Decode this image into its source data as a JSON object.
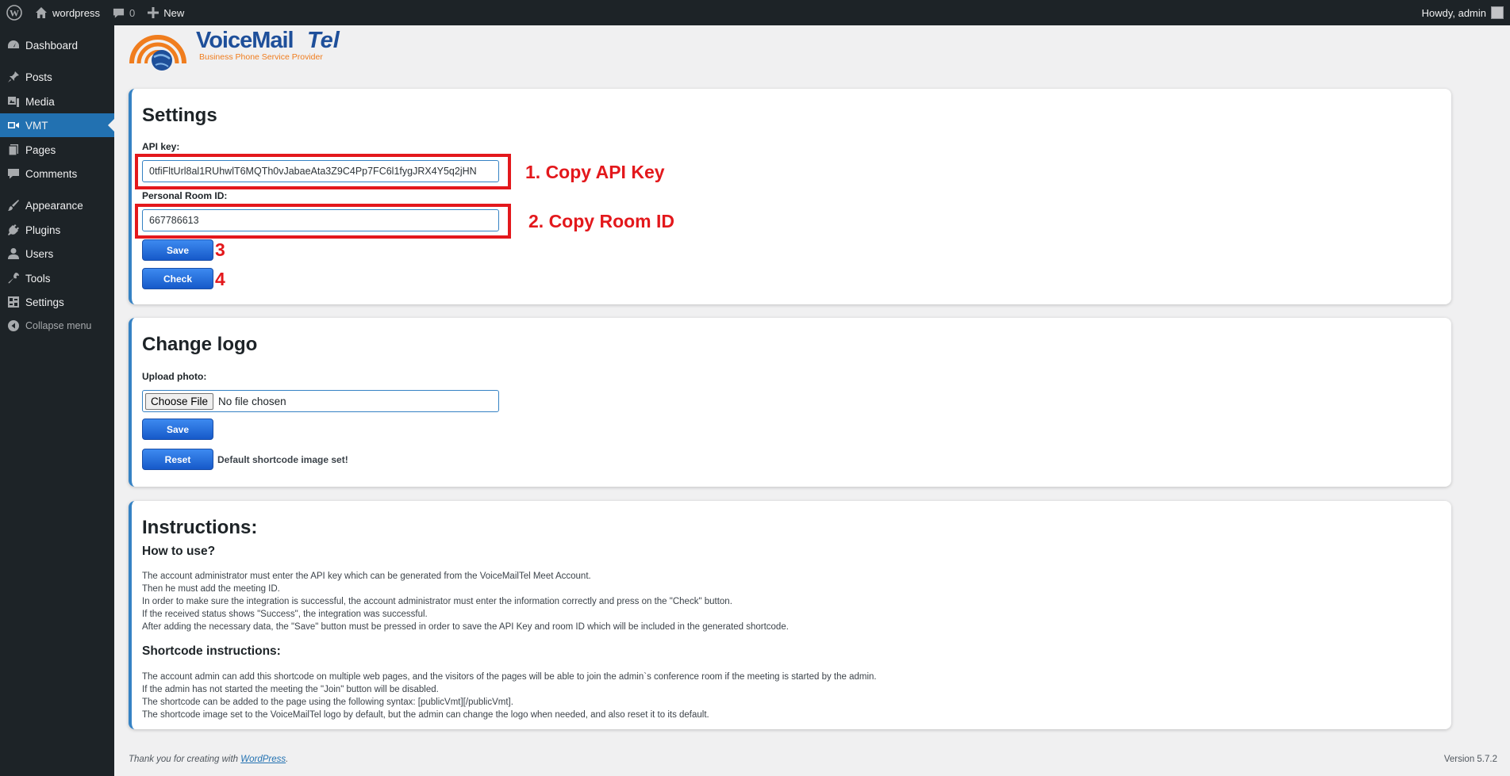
{
  "adminbar": {
    "site_name": "wordpress",
    "comments_count": "0",
    "new_label": "New",
    "howdy": "Howdy, admin"
  },
  "sidebar": {
    "items": [
      {
        "label": "Dashboard",
        "icon": "dashboard-icon"
      },
      {
        "label": "Posts",
        "icon": "pin-icon"
      },
      {
        "label": "Media",
        "icon": "media-icon"
      },
      {
        "label": "VMT",
        "icon": "video-camera-icon"
      },
      {
        "label": "Pages",
        "icon": "pages-icon"
      },
      {
        "label": "Comments",
        "icon": "comment-icon"
      },
      {
        "label": "Appearance",
        "icon": "brush-icon"
      },
      {
        "label": "Plugins",
        "icon": "plug-icon"
      },
      {
        "label": "Users",
        "icon": "user-icon"
      },
      {
        "label": "Tools",
        "icon": "wrench-icon"
      },
      {
        "label": "Settings",
        "icon": "settings-icon"
      },
      {
        "label": "Collapse menu",
        "icon": "collapse-icon"
      }
    ]
  },
  "logo": {
    "brand_main": "VoiceMail",
    "brand_accent": "Tel",
    "tagline": "Business Phone Service Provider"
  },
  "settings": {
    "title": "Settings",
    "api_key_label": "API key:",
    "api_key_value": "0tfiFltUrl8al1RUhwlT6MQTh0vJabaeAta3Z9C4Pp7FC6l1fygJRX4Y5q2jHN",
    "room_id_label": "Personal Room ID:",
    "room_id_value": "667786613",
    "save_label": "Save",
    "check_label": "Check"
  },
  "annotations": {
    "copy_api": "1. Copy API Key",
    "copy_room": "2. Copy Room ID",
    "step3": "3",
    "step4": "4"
  },
  "change_logo": {
    "title": "Change logo",
    "upload_label": "Upload photo:",
    "choose_file": "Choose File",
    "no_file": "No file chosen",
    "save_label": "Save",
    "reset_label": "Reset",
    "status": "Default shortcode image set!"
  },
  "instructions": {
    "title": "Instructions:",
    "how_to_use": "How to use?",
    "how_lines": [
      "The account administrator must enter the API key which can be generated from the VoiceMailTel Meet Account.",
      "Then he must add the meeting ID.",
      "In order to make sure the integration is successful, the account administrator must enter the information correctly and press on the \"Check\" button.",
      "If the received status shows \"Success\", the integration was successful.",
      "After adding the necessary data, the \"Save\" button must be pressed in order to save the API Key and room ID which will be included in the generated shortcode."
    ],
    "shortcode_title": "Shortcode instructions:",
    "shortcode_lines": [
      "The account admin can add this shortcode on multiple web pages, and the visitors of the pages will be able to join the admin`s conference room if the meeting is started by the admin.",
      "If the admin has not started the meeting the \"Join\" button will be disabled.",
      "The shortcode can be added to the page using the following syntax: [publicVmt][/publicVmt].",
      "The shortcode image set to the VoiceMailTel logo by default, but the admin can change the logo when needed, and also reset it to its default."
    ]
  },
  "footer": {
    "thanks_prefix": "Thank you for creating with ",
    "thanks_link": "WordPress",
    "thanks_suffix": ".",
    "version": "Version 5.7.2"
  },
  "colors": {
    "accent": "#2271b1",
    "annotation_red": "#e3181c",
    "sidebar_bg": "#1d2327"
  }
}
